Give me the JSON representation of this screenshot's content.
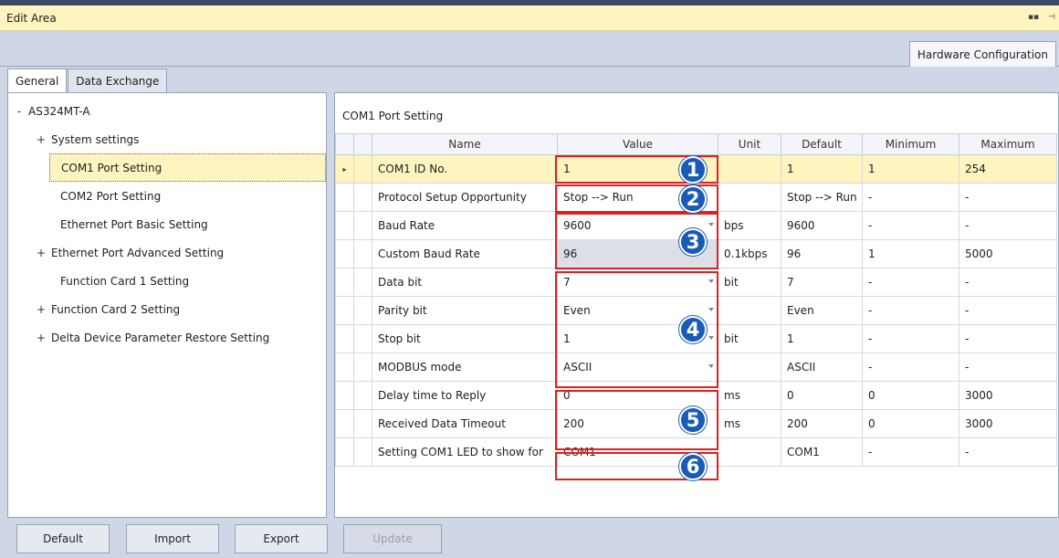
{
  "window": {
    "title": "Edit Area",
    "pin_icon": "pin-icon",
    "restore_icon": "restore-icon"
  },
  "doc_tab": "Hardware Configuration",
  "subtabs": [
    "General",
    "Data Exchange"
  ],
  "tree": {
    "root": {
      "toggle": "-",
      "label": "AS324MT-A"
    },
    "items": [
      {
        "toggle": "+",
        "label": "System settings"
      },
      {
        "toggle": "",
        "label": "COM1 Port Setting",
        "selected": true
      },
      {
        "toggle": "",
        "label": "COM2 Port Setting"
      },
      {
        "toggle": "",
        "label": "Ethernet Port Basic Setting"
      },
      {
        "toggle": "+",
        "label": "Ethernet Port Advanced Setting"
      },
      {
        "toggle": "",
        "label": "Function Card 1 Setting"
      },
      {
        "toggle": "+",
        "label": "Function Card 2 Setting"
      },
      {
        "toggle": "+",
        "label": "Delta Device Parameter Restore Setting"
      }
    ]
  },
  "section_title": "COM1 Port Setting",
  "columns": {
    "name": "Name",
    "value": "Value",
    "unit": "Unit",
    "default": "Default",
    "minimum": "Minimum",
    "maximum": "Maximum"
  },
  "rows": [
    {
      "marker": "▸",
      "name": "COM1 ID No.",
      "value": "1",
      "unit": "",
      "default": "1",
      "min": "1",
      "max": "254"
    },
    {
      "marker": "",
      "name": "Protocol Setup Opportunity",
      "value": "Stop --> Run",
      "unit": "",
      "default": "Stop --> Run",
      "min": "-",
      "max": "-"
    },
    {
      "marker": "",
      "name": "Baud Rate",
      "value": "9600",
      "unit": "bps",
      "default": "9600",
      "min": "-",
      "max": "-"
    },
    {
      "marker": "",
      "name": "Custom Baud Rate",
      "value": "96",
      "unit": "0.1kbps",
      "default": "96",
      "min": "1",
      "max": "5000"
    },
    {
      "marker": "",
      "name": "Data bit",
      "value": "7",
      "unit": "bit",
      "default": "7",
      "min": "-",
      "max": "-"
    },
    {
      "marker": "",
      "name": "Parity bit",
      "value": "Even",
      "unit": "",
      "default": "Even",
      "min": "-",
      "max": "-"
    },
    {
      "marker": "",
      "name": "Stop bit",
      "value": "1",
      "unit": "bit",
      "default": "1",
      "min": "-",
      "max": "-"
    },
    {
      "marker": "",
      "name": "MODBUS mode",
      "value": "ASCII",
      "unit": "",
      "default": "ASCII",
      "min": "-",
      "max": "-"
    },
    {
      "marker": "",
      "name": "Delay time to Reply",
      "value": "0",
      "unit": "ms",
      "default": "0",
      "min": "0",
      "max": "3000"
    },
    {
      "marker": "",
      "name": "Received Data Timeout",
      "value": "200",
      "unit": "ms",
      "default": "200",
      "min": "0",
      "max": "3000"
    },
    {
      "marker": "",
      "name": "Setting COM1 LED to show for",
      "value": "COM1",
      "unit": "",
      "default": "COM1",
      "min": "-",
      "max": "-"
    }
  ],
  "badges": [
    "1",
    "2",
    "3",
    "4",
    "5",
    "6"
  ],
  "buttons": {
    "default": "Default",
    "import": "Import",
    "export": "Export",
    "update": "Update"
  },
  "colors": {
    "highlight": "#fdf4bf",
    "annotation_red": "#e02020",
    "badge_blue": "#1a5bb7"
  }
}
